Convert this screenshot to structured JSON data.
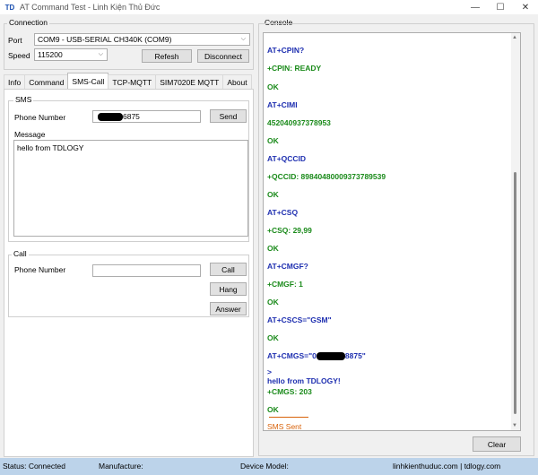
{
  "window": {
    "title": "AT Command Test - Linh Kiện Thủ Đức",
    "icon_text": "TD",
    "minimize_icon": "—",
    "maximize_icon": "☐",
    "close_icon": "✕"
  },
  "connection": {
    "group_label": "Connection",
    "port_label": "Port",
    "port_value": "COM9 - USB-SERIAL CH340K (COM9)",
    "speed_label": "Speed",
    "speed_value": "115200",
    "refresh_label": "Refesh",
    "disconnect_label": "Disconnect"
  },
  "tabs": [
    "Info",
    "Command",
    "SMS-Call",
    "TCP-MQTT",
    "SIM7020E MQTT",
    "About"
  ],
  "active_tab": "SMS-Call",
  "sms": {
    "group_label": "SMS",
    "phone_label": "Phone Number",
    "phone_value_end": "6875",
    "send_label": "Send",
    "message_label": "Message",
    "message_value": "hello from TDLOGY"
  },
  "call": {
    "group_label": "Call",
    "phone_label": "Phone Number",
    "phone_value": "",
    "call_label": "Call",
    "hang_label": "Hang",
    "answer_label": "Answer"
  },
  "console": {
    "group_label": "Console",
    "lines": [
      {
        "text": "AT+CPIN?",
        "color": "blue"
      },
      {
        "text": "+CPIN: READY",
        "color": "green"
      },
      {
        "text": "OK",
        "color": "green"
      },
      {
        "text": "AT+CIMI",
        "color": "blue"
      },
      {
        "text": "452040937378953",
        "color": "green"
      },
      {
        "text": "OK",
        "color": "green"
      },
      {
        "text": "AT+QCCID",
        "color": "blue"
      },
      {
        "text": "+QCCID: 89840480009373789539",
        "color": "green"
      },
      {
        "text": "OK",
        "color": "green"
      },
      {
        "text": "AT+CSQ",
        "color": "blue"
      },
      {
        "text": "+CSQ: 29,99",
        "color": "green"
      },
      {
        "text": "OK",
        "color": "green"
      },
      {
        "text": "AT+CMGF?",
        "color": "blue"
      },
      {
        "text": "+CMGF: 1",
        "color": "green"
      },
      {
        "text": "OK",
        "color": "green"
      },
      {
        "text": "AT+CSCS=\"GSM\"",
        "color": "blue"
      },
      {
        "text": "OK",
        "color": "green"
      },
      {
        "text": "AT+CMGS=\"0",
        "suffix": "8875\"",
        "color": "blue"
      },
      {
        "text": ">",
        "color": "blue"
      },
      {
        "text": "hello from TDLOGY!",
        "color": "blue"
      },
      {
        "text": "+CMGS: 203",
        "color": "green"
      },
      {
        "text": "OK",
        "color": "green"
      },
      {
        "text": "SMS Sent",
        "color": "orange"
      }
    ],
    "clear_label": "Clear"
  },
  "statusbar": {
    "status": "Status: Connected",
    "manufacturer": "Manufacture:",
    "device_model": "Device Model:",
    "website": "linhkienthuduc.com | tdlogy.com"
  }
}
